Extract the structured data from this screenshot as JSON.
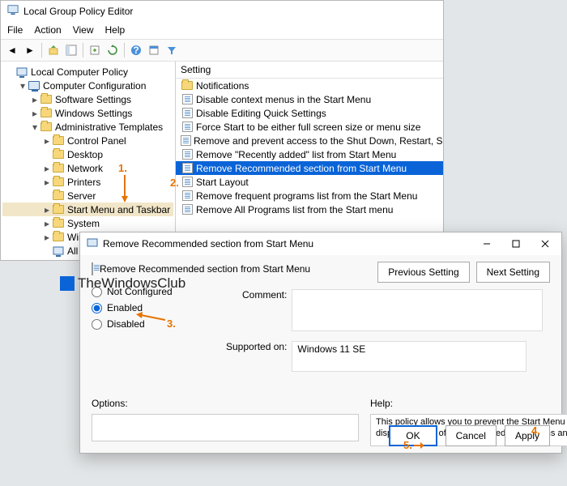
{
  "gp": {
    "title": "Local Group Policy Editor",
    "menu": [
      "File",
      "Action",
      "View",
      "Help"
    ],
    "toolbar_icons": [
      "back",
      "forward",
      "up",
      "show-hide-tree",
      "export",
      "refresh",
      "help",
      "properties",
      "filter"
    ],
    "tree": [
      {
        "depth": 0,
        "twisty": "",
        "icon": "gp",
        "label": "Local Computer Policy"
      },
      {
        "depth": 1,
        "twisty": "▾",
        "icon": "comp",
        "label": "Computer Configuration"
      },
      {
        "depth": 2,
        "twisty": "▸",
        "icon": "folder",
        "label": "Software Settings"
      },
      {
        "depth": 2,
        "twisty": "▸",
        "icon": "folder",
        "label": "Windows Settings"
      },
      {
        "depth": 2,
        "twisty": "▾",
        "icon": "folder",
        "label": "Administrative Templates"
      },
      {
        "depth": 3,
        "twisty": "▸",
        "icon": "folder",
        "label": "Control Panel"
      },
      {
        "depth": 3,
        "twisty": "",
        "icon": "folder",
        "label": "Desktop"
      },
      {
        "depth": 3,
        "twisty": "▸",
        "icon": "folder",
        "label": "Network"
      },
      {
        "depth": 3,
        "twisty": "▸",
        "icon": "folder",
        "label": "Printers"
      },
      {
        "depth": 3,
        "twisty": "",
        "icon": "folder",
        "label": "Server"
      },
      {
        "depth": 3,
        "twisty": "▸",
        "icon": "folder",
        "label": "Start Menu and Taskbar",
        "selected": true
      },
      {
        "depth": 3,
        "twisty": "▸",
        "icon": "folder",
        "label": "System"
      },
      {
        "depth": 3,
        "twisty": "▸",
        "icon": "folder",
        "label": "Windows Components"
      },
      {
        "depth": 3,
        "twisty": "",
        "icon": "gp",
        "label": "All Settings"
      }
    ],
    "list_header": "Setting",
    "list": [
      {
        "icon": "folder",
        "label": "Notifications"
      },
      {
        "icon": "policy",
        "label": "Disable context menus in the Start Menu"
      },
      {
        "icon": "policy",
        "label": "Disable Editing Quick Settings"
      },
      {
        "icon": "policy",
        "label": "Force Start to be either full screen size or menu size"
      },
      {
        "icon": "policy",
        "label": "Remove and prevent access to the Shut Down, Restart, Sleep, and Hibernate commands"
      },
      {
        "icon": "policy",
        "label": "Remove \"Recently added\" list from Start Menu"
      },
      {
        "icon": "policy",
        "label": "Remove Recommended section from Start Menu",
        "selected": true
      },
      {
        "icon": "policy",
        "label": "Start Layout"
      },
      {
        "icon": "policy",
        "label": "Remove frequent programs list from the Start Menu"
      },
      {
        "icon": "policy",
        "label": "Remove All Programs list from the Start menu"
      }
    ]
  },
  "dlg": {
    "title": "Remove Recommended section from Start Menu",
    "heading": "Remove Recommended section from Start Menu",
    "prev": "Previous Setting",
    "next": "Next Setting",
    "radios": {
      "not_configured": "Not Configured",
      "enabled": "Enabled",
      "disabled": "Disabled",
      "selected": "enabled"
    },
    "comment_label": "Comment:",
    "comment_value": "",
    "supported_label": "Supported on:",
    "supported_value": "Windows 11 SE",
    "options_label": "Options:",
    "help_label": "Help:",
    "help_text": "This policy allows you to prevent the Start Menu from displaying a list of recommended applications and files.",
    "ok": "OK",
    "cancel": "Cancel",
    "apply": "Apply"
  },
  "annot": {
    "n1": "1.",
    "n2": "2.",
    "n3": "3.",
    "n4": "4.",
    "n5": "5."
  },
  "watermark": "TheWindowsClub"
}
